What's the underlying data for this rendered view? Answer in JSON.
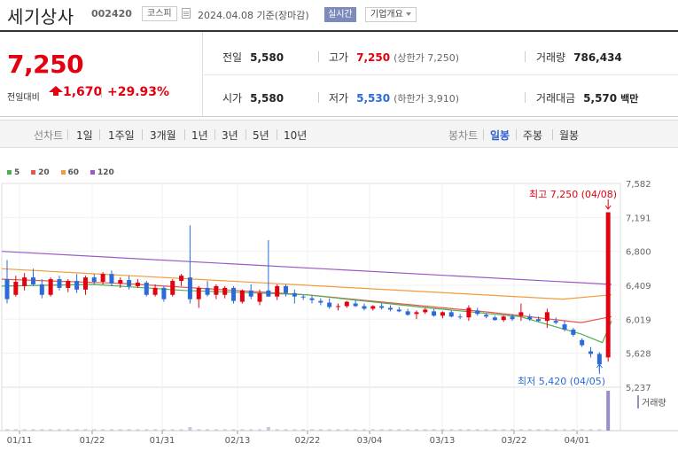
{
  "header": {
    "name": "세기상사",
    "code": "002420",
    "market": "코스피",
    "date": "2024.04.08 기준(장마감)",
    "realtime": "실시간",
    "company": "기업개요"
  },
  "price": {
    "current": "7,250",
    "change_label": "전일대비",
    "change": "1,670",
    "change_pct": "+29.93%"
  },
  "stats": {
    "prev_close": {
      "label": "전일",
      "value": "5,580"
    },
    "high": {
      "label": "고가",
      "value": "7,250",
      "sub": "(상한가 7,250)"
    },
    "volume": {
      "label": "거래량",
      "value": "786,434"
    },
    "open": {
      "label": "시가",
      "value": "5,580"
    },
    "low": {
      "label": "저가",
      "value": "5,530",
      "sub": "(하한가 3,910)"
    },
    "amount": {
      "label": "거래대금",
      "value": "5,570",
      "unit": "백만"
    }
  },
  "period_bar": {
    "line_label": "선차트",
    "line_periods": [
      "1일",
      "1주일",
      "3개월",
      "1년",
      "3년",
      "5년",
      "10년"
    ],
    "candle_label": "봉차트",
    "candle_periods": [
      "일봉",
      "주봉",
      "월봉"
    ],
    "active_candle": "일봉"
  },
  "colors": {
    "up": "#e3000f",
    "down": "#2b6ad8",
    "ma5": "#4caf50",
    "ma20": "#e8554e",
    "ma60": "#f39c3c",
    "ma120": "#9b59c6"
  },
  "chart_data": {
    "type": "candlestick",
    "legend": [
      "5",
      "20",
      "60",
      "120"
    ],
    "y_ticks": [
      "7,582",
      "7,191",
      "6,800",
      "6,409",
      "6,019",
      "5,628",
      "5,237"
    ],
    "ylim": [
      5237,
      7582
    ],
    "x_ticks": [
      "01/11",
      "01/22",
      "01/31",
      "02/13",
      "02/22",
      "03/04",
      "03/13",
      "03/22",
      "04/01"
    ],
    "candles": [
      [
        6480,
        6700,
        6200,
        6250
      ],
      [
        6300,
        6520,
        6280,
        6450
      ],
      [
        6400,
        6550,
        6350,
        6500
      ],
      [
        6500,
        6600,
        6400,
        6420
      ],
      [
        6420,
        6480,
        6260,
        6300
      ],
      [
        6300,
        6500,
        6280,
        6480
      ],
      [
        6480,
        6520,
        6350,
        6380
      ],
      [
        6380,
        6480,
        6330,
        6460
      ],
      [
        6460,
        6540,
        6320,
        6360
      ],
      [
        6360,
        6520,
        6300,
        6500
      ],
      [
        6500,
        6540,
        6420,
        6450
      ],
      [
        6450,
        6560,
        6420,
        6540
      ],
      [
        6540,
        6580,
        6400,
        6430
      ],
      [
        6430,
        6500,
        6380,
        6470
      ],
      [
        6470,
        6520,
        6360,
        6400
      ],
      [
        6400,
        6480,
        6380,
        6440
      ],
      [
        6440,
        6460,
        6280,
        6300
      ],
      [
        6300,
        6420,
        6280,
        6380
      ],
      [
        6380,
        6400,
        6220,
        6250
      ],
      [
        6300,
        6480,
        6280,
        6460
      ],
      [
        6460,
        6540,
        6400,
        6520
      ],
      [
        6500,
        7100,
        6200,
        6250
      ],
      [
        6250,
        6400,
        6150,
        6380
      ],
      [
        6380,
        6460,
        6280,
        6300
      ],
      [
        6300,
        6420,
        6250,
        6400
      ],
      [
        6300,
        6400,
        6260,
        6380
      ],
      [
        6380,
        6400,
        6200,
        6230
      ],
      [
        6220,
        6360,
        6200,
        6350
      ],
      [
        6350,
        6420,
        6250,
        6280
      ],
      [
        6220,
        6360,
        6180,
        6320
      ],
      [
        6350,
        6930,
        6280,
        6280
      ],
      [
        6280,
        6420,
        6240,
        6400
      ],
      [
        6400,
        6420,
        6280,
        6320
      ],
      [
        6320,
        6360,
        6200,
        6280
      ],
      [
        6280,
        6300,
        6240,
        6270
      ],
      [
        6260,
        6290,
        6200,
        6240
      ],
      [
        6230,
        6260,
        6180,
        6210
      ],
      [
        6210,
        6260,
        6140,
        6160
      ],
      [
        6160,
        6200,
        6120,
        6170
      ],
      [
        6170,
        6230,
        6150,
        6220
      ],
      [
        6200,
        6240,
        6160,
        6170
      ],
      [
        6170,
        6200,
        6120,
        6140
      ],
      [
        6140,
        6180,
        6120,
        6170
      ],
      [
        6170,
        6200,
        6130,
        6150
      ],
      [
        6150,
        6180,
        6110,
        6130
      ],
      [
        6130,
        6160,
        6100,
        6110
      ],
      [
        6110,
        6140,
        6060,
        6070
      ],
      [
        6080,
        6120,
        6020,
        6100
      ],
      [
        6100,
        6150,
        6080,
        6130
      ],
      [
        6110,
        6140,
        6050,
        6060
      ],
      [
        6060,
        6110,
        6030,
        6100
      ],
      [
        6100,
        6120,
        6040,
        6050
      ],
      [
        6050,
        6080,
        6020,
        6040
      ],
      [
        6040,
        6180,
        6000,
        6150
      ],
      [
        6120,
        6150,
        6060,
        6080
      ],
      [
        6070,
        6090,
        6030,
        6050
      ],
      [
        6040,
        6060,
        6000,
        6010
      ],
      [
        6010,
        6060,
        5990,
        6050
      ],
      [
        6050,
        6080,
        6000,
        6020
      ],
      [
        6060,
        6200,
        6000,
        6100
      ],
      [
        6050,
        6080,
        6000,
        6020
      ],
      [
        6020,
        6050,
        5990,
        6000
      ],
      [
        6000,
        6140,
        5920,
        6100
      ],
      [
        6000,
        6040,
        5960,
        5980
      ],
      [
        5960,
        6000,
        5880,
        5900
      ],
      [
        5900,
        5920,
        5820,
        5840
      ],
      [
        5780,
        5800,
        5700,
        5720
      ],
      [
        5650,
        5700,
        5580,
        5620
      ],
      [
        5620,
        5640,
        5420,
        5500
      ],
      [
        5580,
        7250,
        5530,
        7250
      ]
    ],
    "ma": {
      "ma120": [
        [
          6800,
          0
        ],
        [
          6420,
          1
        ]
      ],
      "ma60": [
        [
          6600,
          0
        ],
        [
          6250,
          0.92
        ],
        [
          6300,
          1
        ]
      ],
      "ma20": [
        [
          6480,
          0
        ],
        [
          6430,
          0.2
        ],
        [
          6300,
          0.5
        ],
        [
          6100,
          0.8
        ],
        [
          5980,
          0.95
        ],
        [
          6050,
          1
        ]
      ],
      "ma5": [
        [
          6400,
          0
        ],
        [
          6420,
          0.15
        ],
        [
          6350,
          0.3
        ],
        [
          6300,
          0.5
        ],
        [
          6150,
          0.7
        ],
        [
          6050,
          0.85
        ],
        [
          5850,
          0.95
        ],
        [
          5750,
          0.985
        ],
        [
          6000,
          1
        ]
      ]
    },
    "annotations": {
      "high": "최고 7,250 (04/08)",
      "low": "최저 5,420 (04/05)"
    },
    "volume_label": "거래량"
  }
}
